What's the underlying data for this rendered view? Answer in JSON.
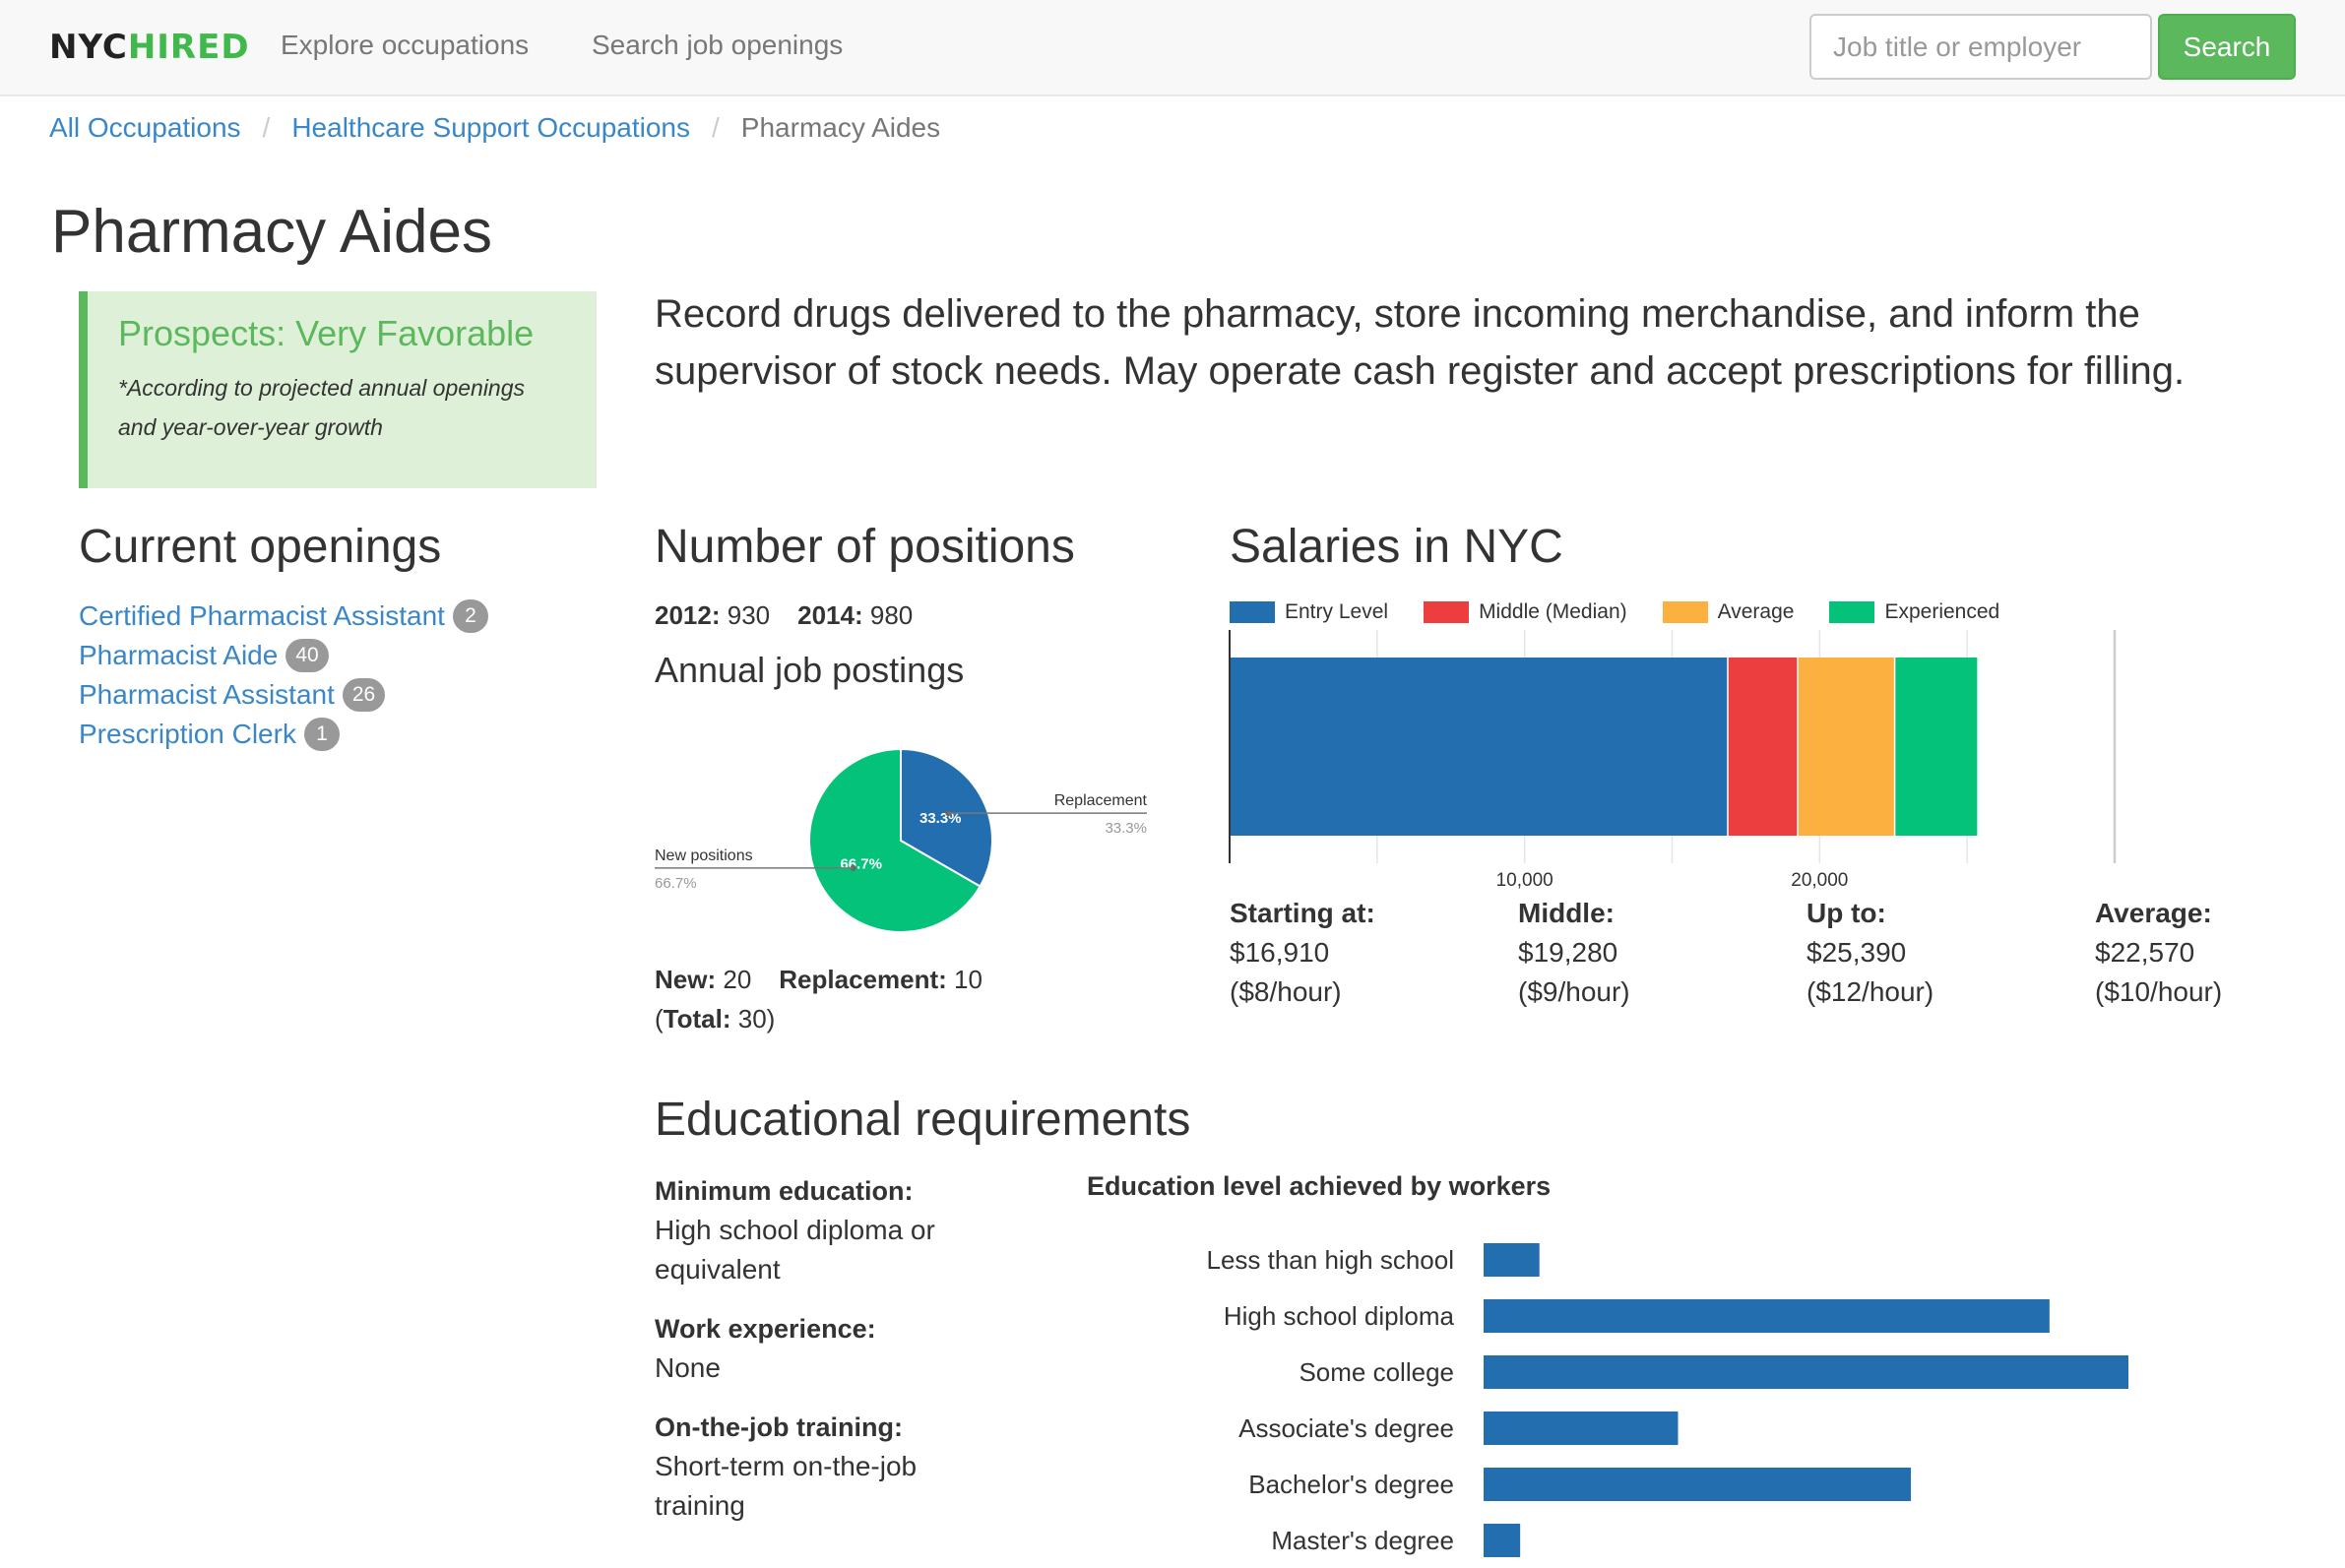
{
  "header": {
    "logo_part1": "NYC",
    "logo_part2": "HIRED",
    "nav": [
      {
        "label": "Explore occupations"
      },
      {
        "label": "Search job openings"
      }
    ],
    "search": {
      "placeholder": "Job title or employer",
      "value": "",
      "button_label": "Search"
    }
  },
  "breadcrumb": [
    {
      "label": "All Occupations"
    },
    {
      "label": "Healthcare Support Occupations"
    },
    {
      "label": "Pharmacy Aides"
    }
  ],
  "breadcrumb_separator": "/",
  "page_title": "Pharmacy Aides",
  "prospects": {
    "title": "Prospects: Very Favorable",
    "note": "*According to projected annual openings and year-over-year growth"
  },
  "description": "Record drugs delivered to the pharmacy, store incoming merchandise, and inform the supervisor of stock needs. May operate cash register and accept prescriptions for filling.",
  "current_openings": {
    "heading": "Current openings",
    "items": [
      {
        "title": "Certified Pharmacist Assistant",
        "count": "2"
      },
      {
        "title": "Pharmacist Aide",
        "count": "40"
      },
      {
        "title": "Pharmacist Assistant",
        "count": "26"
      },
      {
        "title": "Prescription Clerk",
        "count": "1"
      }
    ]
  },
  "positions": {
    "heading": "Number of positions",
    "y2012_label": "2012:",
    "y2012_value": "930",
    "y2014_label": "2014:",
    "y2014_value": "980",
    "postings_heading": "Annual job postings",
    "new_label": "New:",
    "new_value": "20",
    "replacement_label": "Replacement:",
    "replacement_value": "10",
    "total_open": "(",
    "total_label": "Total:",
    "total_value": "30",
    "total_close": ")"
  },
  "salaries": {
    "heading": "Salaries in NYC",
    "details": [
      {
        "label": "Starting at:",
        "annual": "$16,910",
        "hourly": "($8/hour)"
      },
      {
        "label": "Middle:",
        "annual": "$19,280",
        "hourly": "($9/hour)"
      },
      {
        "label": "Up to:",
        "annual": "$25,390",
        "hourly": "($12/hour)"
      },
      {
        "label": "Average:",
        "annual": "$22,570",
        "hourly": "($10/hour)"
      }
    ]
  },
  "education": {
    "heading": "Educational requirements",
    "requirements": [
      {
        "label": "Minimum education:",
        "value": "High school diploma or equivalent"
      },
      {
        "label": "Work experience:",
        "value": "None"
      },
      {
        "label": "On-the-job training:",
        "value": "Short-term on-the-job training"
      }
    ],
    "chart_title": "Education level achieved by workers"
  },
  "chart_data": [
    {
      "id": "annual-job-postings",
      "type": "pie",
      "title": "Annual job postings",
      "slices": [
        {
          "label": "Replacement",
          "value": 10,
          "percent": "33.3%",
          "color": "#226eae"
        },
        {
          "label": "New positions",
          "value": 20,
          "percent": "66.7%",
          "color": "#05c27a"
        }
      ]
    },
    {
      "id": "salaries-nyc",
      "type": "bar",
      "orientation": "horizontal-stacked",
      "title": "Salaries in NYC",
      "xlabel": "",
      "ylabel": "",
      "xlim": [
        0,
        30000
      ],
      "grid": true,
      "gridline_values": [
        0,
        5000,
        10000,
        15000,
        20000,
        25000,
        30000
      ],
      "tick_labels": [
        {
          "value": 10000,
          "label": "10,000"
        },
        {
          "value": 20000,
          "label": "20,000"
        }
      ],
      "legend_position": "top-left",
      "series": [
        {
          "name": "Entry Level",
          "start": 0,
          "end": 16910,
          "color": "#226eae"
        },
        {
          "name": "Middle (Median)",
          "start": 16910,
          "end": 19280,
          "color": "#ec3d3f"
        },
        {
          "name": "Average",
          "start": 19280,
          "end": 22570,
          "color": "#fbb040"
        },
        {
          "name": "Experienced",
          "start": 22570,
          "end": 25390,
          "color": "#05c27a"
        }
      ]
    },
    {
      "id": "education-level",
      "type": "bar",
      "orientation": "horizontal",
      "title": "Education level achieved by workers",
      "xlabel": "",
      "ylabel": "",
      "value_unit": "estimated % of workers (unlabeled in chart)",
      "categories": [
        "Less than high school",
        "High school diploma",
        "Some college",
        "Associate's degree",
        "Bachelor's degree",
        "Master's degree"
      ],
      "values": [
        2.9,
        29.4,
        33.5,
        10.1,
        22.2,
        1.9
      ],
      "color": "#226eae"
    }
  ]
}
